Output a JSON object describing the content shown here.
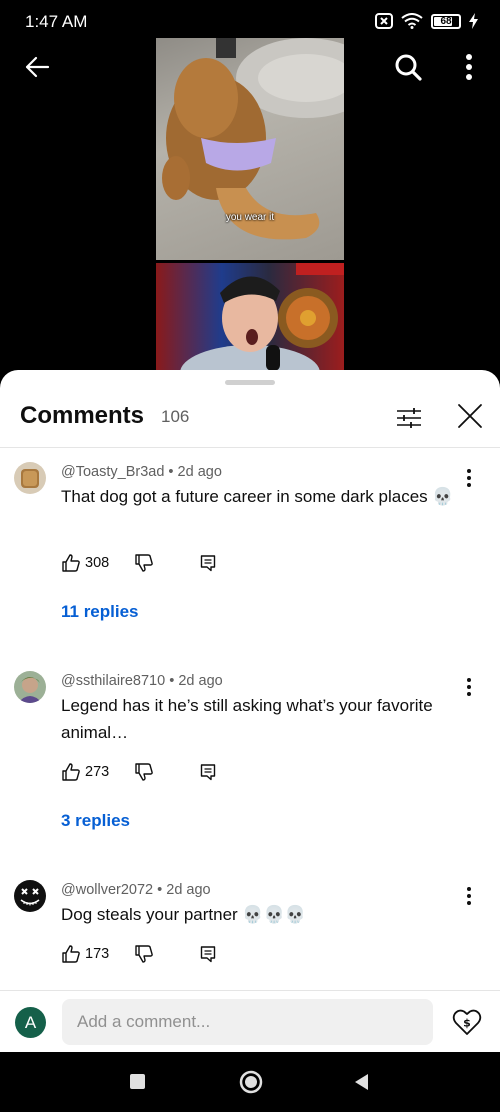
{
  "status": {
    "time": "1:47 AM",
    "battery": "68",
    "icons": [
      "sim-off-icon",
      "wifi-icon",
      "battery-icon",
      "charging-icon"
    ]
  },
  "player": {
    "caption": "you wear it",
    "icons": [
      "back-arrow-icon",
      "search-icon",
      "more-vert-icon"
    ]
  },
  "comments_panel": {
    "title": "Comments",
    "count": "106",
    "icons": [
      "filter-icon",
      "close-icon"
    ],
    "comments": [
      {
        "author": "@Toasty_Br3ad",
        "age": "2d ago",
        "text": "That dog got a future career in some dark places 💀",
        "likes": "308",
        "replies": "11 replies"
      },
      {
        "author": "@ssthilaire8710",
        "age": "2d ago",
        "text": "Legend has it he’s still asking what’s your favorite animal…",
        "likes": "273",
        "replies": "3 replies"
      },
      {
        "author": "@wollver2072",
        "age": "2d ago",
        "text": "Dog steals your partner 💀💀💀",
        "likes": "173"
      }
    ]
  },
  "add_comment": {
    "avatar_letter": "A",
    "placeholder": "Add a comment...",
    "accent": "#15604a"
  },
  "colors": {
    "link": "#065fd4",
    "text": "#0f0f0f",
    "secondary": "#606060"
  }
}
